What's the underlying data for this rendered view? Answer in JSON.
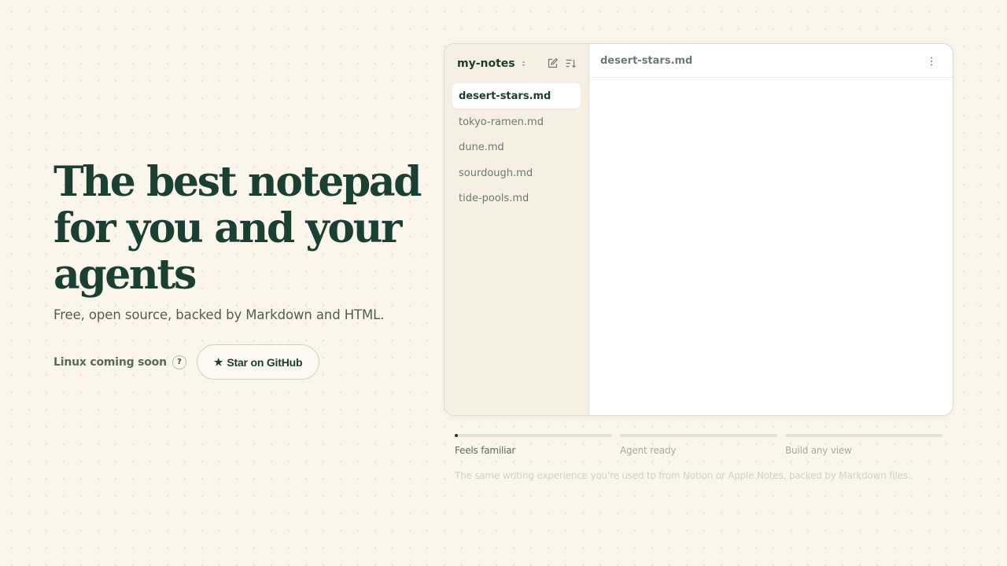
{
  "hero": {
    "title_lines": [
      "The best notepad",
      "for you and your",
      "agents"
    ],
    "subtitle": "Free, open source, backed by Markdown and HTML.",
    "linux_note": "Linux coming soon",
    "help_glyph": "?",
    "github_button": {
      "star_glyph": "★",
      "label": "Star on GitHub"
    }
  },
  "app": {
    "workspace": "my-notes",
    "sidebar_actions": [
      "new-note-icon",
      "sort-icon"
    ],
    "files": [
      "desert-stars.md",
      "tokyo-ramen.md",
      "dune.md",
      "sourdough.md",
      "tide-pools.md"
    ],
    "active_file_index": 0,
    "editor_title": "desert-stars.md",
    "editor_menu_icon": "more-vertical-icon"
  },
  "features": {
    "items": [
      {
        "label": "Feels familiar",
        "progress": 0.02
      },
      {
        "label": "Agent ready",
        "progress": 0
      },
      {
        "label": "Build any view",
        "progress": 0
      }
    ],
    "active_index": 0,
    "description": "The same writing experience you're used to from Notion or Apple Notes, backed by Markdown files."
  },
  "colors": {
    "background": "#faf6ec",
    "primary_text": "#1b3f31",
    "sidebar_bg": "#f6f0e4",
    "progress_fill": "#1c3d30",
    "progress_track": "#e4e1d5"
  }
}
